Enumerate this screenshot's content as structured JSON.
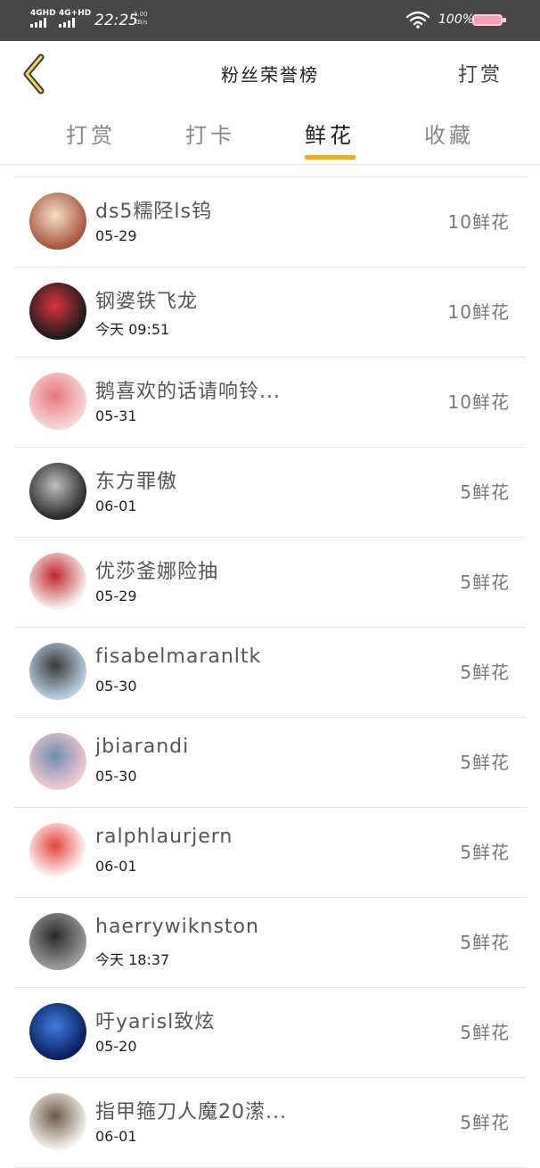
{
  "status_bar": {
    "network_1": "4GHD",
    "network_2": "4G+HD",
    "time": "22:25",
    "speed_value": "1.00",
    "speed_unit": "KB/s",
    "battery": "100%"
  },
  "nav": {
    "title": "粉丝荣誉榜",
    "action": "打赏"
  },
  "tabs": [
    {
      "label": "打赏",
      "active": false
    },
    {
      "label": "打卡",
      "active": false
    },
    {
      "label": "鲜花",
      "active": true
    },
    {
      "label": "收藏",
      "active": false
    }
  ],
  "rows": [
    {
      "name": "ds5糯陉ls钨",
      "date": "05-29",
      "amount": "10鲜花",
      "avatar_colors": [
        "#a9553d",
        "#f2e1c8"
      ]
    },
    {
      "name": "钢婆铁飞龙",
      "date": "今天 09:51",
      "amount": "10鲜花",
      "avatar_colors": [
        "#1c1c1c",
        "#d9343c"
      ]
    },
    {
      "name": "鹅喜欢的话请响铃...",
      "date": "05-31",
      "amount": "10鲜花",
      "avatar_colors": [
        "#f4d7d7",
        "#e8777c"
      ]
    },
    {
      "name": "东方罪傲",
      "date": "06-01",
      "amount": "5鲜花",
      "avatar_colors": [
        "#2a2a2a",
        "#bfbfbf"
      ]
    },
    {
      "name": "优莎釜娜险抽",
      "date": "05-29",
      "amount": "5鲜花",
      "avatar_colors": [
        "#f5f0ec",
        "#c0262c"
      ]
    },
    {
      "name": "fisabelmaranltk",
      "date": "05-30",
      "amount": "5鲜花",
      "avatar_colors": [
        "#b7cde0",
        "#3a3a3a"
      ]
    },
    {
      "name": "jbiarandi",
      "date": "05-30",
      "amount": "5鲜花",
      "avatar_colors": [
        "#f2c8cf",
        "#6d8fb3"
      ]
    },
    {
      "name": "ralphlaurjern",
      "date": "06-01",
      "amount": "5鲜花",
      "avatar_colors": [
        "#ffffff",
        "#e3443a"
      ]
    },
    {
      "name": "haerrywiknston",
      "date": "今天 18:37",
      "amount": "5鲜花",
      "avatar_colors": [
        "#9a9a9a",
        "#2b2b2b"
      ]
    },
    {
      "name": "吁yarisl致炫",
      "date": "05-20",
      "amount": "5鲜花",
      "avatar_colors": [
        "#0b1e5c",
        "#3e7de0"
      ]
    },
    {
      "name": "指甲箍刀人魔20潆...",
      "date": "06-01",
      "amount": "5鲜花",
      "avatar_colors": [
        "#f3f0ea",
        "#6c5a46"
      ]
    }
  ],
  "colors": {
    "accent": "#f5a623",
    "status_bar_bg": "#474747"
  }
}
